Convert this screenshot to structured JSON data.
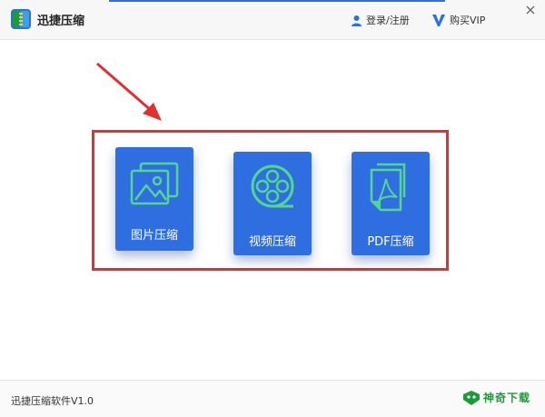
{
  "app": {
    "title": "迅捷压缩"
  },
  "header": {
    "login_label": "登录/注册",
    "vip_label": "购买VIP"
  },
  "cards": [
    {
      "label": "图片压缩",
      "icon": "image-icon"
    },
    {
      "label": "视频压缩",
      "icon": "film-reel-icon"
    },
    {
      "label": "PDF压缩",
      "icon": "pdf-document-icon"
    }
  ],
  "footer": {
    "version": "迅捷压缩软件V1.0",
    "watermark": "神奇下载"
  },
  "colors": {
    "accent": "#2f6ee0",
    "highlight": "#e13030",
    "icon_green": "#53d690",
    "watermark": "#1f9a3a"
  }
}
